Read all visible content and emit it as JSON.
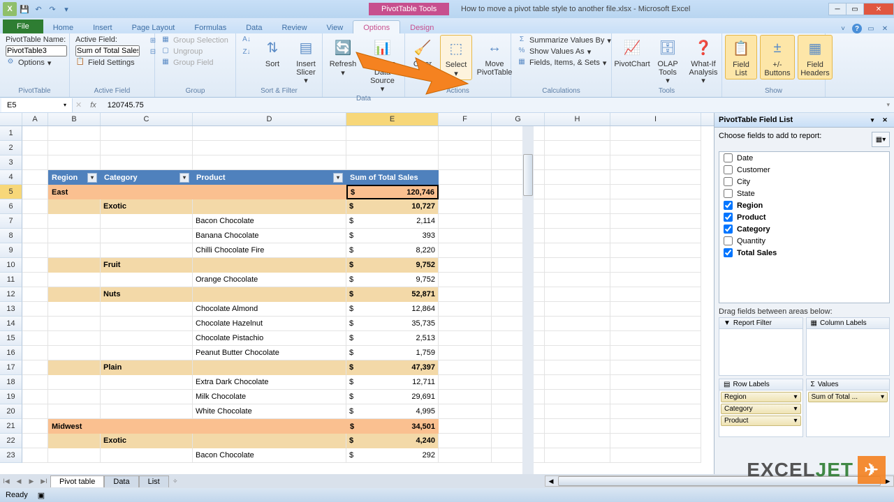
{
  "window": {
    "contextual_label": "PivotTable Tools",
    "title": "How to move a pivot table style to another file.xlsx - Microsoft Excel"
  },
  "tabs": {
    "file": "File",
    "home": "Home",
    "insert": "Insert",
    "pagelayout": "Page Layout",
    "formulas": "Formulas",
    "data": "Data",
    "review": "Review",
    "view": "View",
    "options": "Options",
    "design": "Design"
  },
  "ribbon": {
    "pt_name_label": "PivotTable Name:",
    "pt_name_value": "PivotTable3",
    "pt_options": "Options",
    "pt_group": "PivotTable",
    "af_label": "Active Field:",
    "af_value": "Sum of Total Sales",
    "af_settings": "Field Settings",
    "af_group": "Active Field",
    "grp_sel": "Group Selection",
    "ungroup": "Ungroup",
    "grp_field": "Group Field",
    "grp_group": "Group",
    "sort": "Sort",
    "slicer1": "Insert",
    "slicer2": "Slicer",
    "sf_group": "Sort & Filter",
    "refresh": "Refresh",
    "chgsrc1": "Change Data",
    "chgsrc2": "Source",
    "data_group": "Data",
    "clear": "Clear",
    "select": "Select",
    "move1": "Move",
    "move2": "PivotTable",
    "actions_group": "Actions",
    "summarize": "Summarize Values By",
    "showas": "Show Values As",
    "fis": "Fields, Items, & Sets",
    "calc_group": "Calculations",
    "pchart": "PivotChart",
    "olap1": "OLAP",
    "olap2": "Tools",
    "whatif1": "What-If",
    "whatif2": "Analysis",
    "tools_group": "Tools",
    "flist1": "Field",
    "flist2": "List",
    "pm1": "+/-",
    "pm2": "Buttons",
    "fh1": "Field",
    "fh2": "Headers",
    "show_group": "Show"
  },
  "formula": {
    "cellref": "E5",
    "fxicon": "fx",
    "value": "120745.75"
  },
  "cols": {
    "A": "A",
    "B": "B",
    "C": "C",
    "D": "D",
    "E": "E",
    "F": "F",
    "G": "G",
    "H": "H",
    "I": "I"
  },
  "pivot": {
    "hdr_region": "Region",
    "hdr_category": "Category",
    "hdr_product": "Product",
    "hdr_sum": "Sum of Total Sales",
    "rows": [
      {
        "r": 5,
        "type": "region",
        "label": "East",
        "cur": "$",
        "val": "120,746"
      },
      {
        "r": 6,
        "type": "cat",
        "label": "Exotic",
        "cur": "$",
        "val": "10,727"
      },
      {
        "r": 7,
        "type": "p",
        "label": "Bacon Chocolate",
        "cur": "$",
        "val": "2,114"
      },
      {
        "r": 8,
        "type": "p",
        "label": "Banana Chocolate",
        "cur": "$",
        "val": "393"
      },
      {
        "r": 9,
        "type": "p",
        "label": "Chilli Chocolate Fire",
        "cur": "$",
        "val": "8,220"
      },
      {
        "r": 10,
        "type": "cat",
        "label": "Fruit",
        "cur": "$",
        "val": "9,752"
      },
      {
        "r": 11,
        "type": "p",
        "label": "Orange Chocolate",
        "cur": "$",
        "val": "9,752"
      },
      {
        "r": 12,
        "type": "cat",
        "label": "Nuts",
        "cur": "$",
        "val": "52,871"
      },
      {
        "r": 13,
        "type": "p",
        "label": "Chocolate Almond",
        "cur": "$",
        "val": "12,864"
      },
      {
        "r": 14,
        "type": "p",
        "label": "Chocolate Hazelnut",
        "cur": "$",
        "val": "35,735"
      },
      {
        "r": 15,
        "type": "p",
        "label": "Chocolate Pistachio",
        "cur": "$",
        "val": "2,513"
      },
      {
        "r": 16,
        "type": "p",
        "label": "Peanut Butter Chocolate",
        "cur": "$",
        "val": "1,759"
      },
      {
        "r": 17,
        "type": "cat",
        "label": "Plain",
        "cur": "$",
        "val": "47,397"
      },
      {
        "r": 18,
        "type": "p",
        "label": "Extra Dark Chocolate",
        "cur": "$",
        "val": "12,711"
      },
      {
        "r": 19,
        "type": "p",
        "label": "Milk Chocolate",
        "cur": "$",
        "val": "29,691"
      },
      {
        "r": 20,
        "type": "p",
        "label": "White Chocolate",
        "cur": "$",
        "val": "4,995"
      },
      {
        "r": 21,
        "type": "region",
        "label": "Midwest",
        "cur": "$",
        "val": "34,501"
      },
      {
        "r": 22,
        "type": "cat",
        "label": "Exotic",
        "cur": "$",
        "val": "4,240"
      },
      {
        "r": 23,
        "type": "p",
        "label": "Bacon Chocolate",
        "cur": "$",
        "val": "292"
      }
    ]
  },
  "fieldlist": {
    "title": "PivotTable Field List",
    "choose": "Choose fields to add to report:",
    "fields": [
      {
        "name": "Date",
        "sel": false
      },
      {
        "name": "Customer",
        "sel": false
      },
      {
        "name": "City",
        "sel": false
      },
      {
        "name": "State",
        "sel": false
      },
      {
        "name": "Region",
        "sel": true
      },
      {
        "name": "Product",
        "sel": true
      },
      {
        "name": "Category",
        "sel": true
      },
      {
        "name": "Quantity",
        "sel": false
      },
      {
        "name": "Total Sales",
        "sel": true
      }
    ],
    "drag": "Drag fields between areas below:",
    "filter": "Report Filter",
    "cols": "Column Labels",
    "rows": "Row Labels",
    "vals": "Values",
    "rowitems": [
      "Region",
      "Category",
      "Product"
    ],
    "valitems": [
      "Sum of Total ..."
    ]
  },
  "sheets": {
    "s1": "Pivot table",
    "s2": "Data",
    "s3": "List"
  },
  "status": {
    "ready": "Ready"
  },
  "watermark": {
    "a": "EXCEL",
    "b": "JET"
  }
}
